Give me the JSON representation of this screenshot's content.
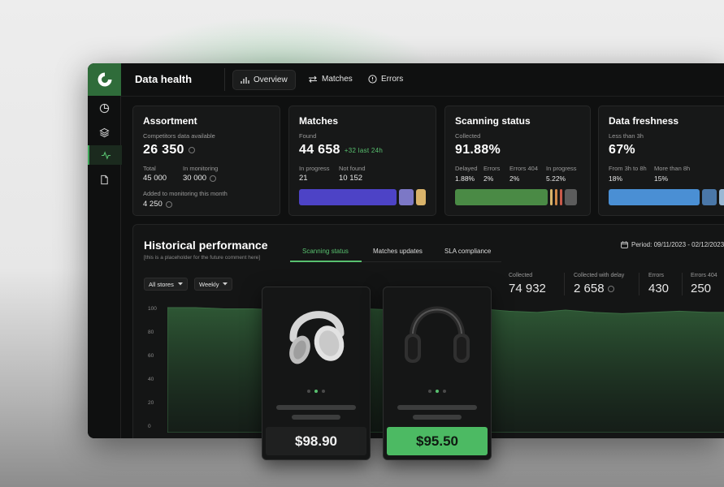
{
  "colors": {
    "accent": "#58c06f",
    "brand": "#2f6c3a",
    "window_bg": "#0f1010",
    "card_bg": "#171818"
  },
  "sidebar": {
    "items": [
      {
        "icon": "pie-chart-icon"
      },
      {
        "icon": "layers-icon"
      },
      {
        "icon": "activity-icon",
        "active": true
      },
      {
        "icon": "document-icon"
      }
    ]
  },
  "header": {
    "title": "Data health",
    "tabs": [
      {
        "label": "Overview",
        "icon": "bar-chart-icon",
        "active": true
      },
      {
        "label": "Matches",
        "icon": "swap-arrows-icon"
      },
      {
        "label": "Errors",
        "icon": "alert-circle-icon"
      }
    ]
  },
  "cards": {
    "assortment": {
      "title": "Assortment",
      "subtitle": "Competitors data available",
      "main": "26 350",
      "total_label": "Total",
      "total": "45 000",
      "monitoring_label": "In monitoring",
      "monitoring": "30 000",
      "added_label": "Added to monitoring this month",
      "added": "4 250"
    },
    "matches": {
      "title": "Matches",
      "subtitle": "Found",
      "main": "44 658",
      "delta": "+32 last 24h",
      "progress_label": "In progress",
      "progress": "21",
      "notfound_label": "Not found",
      "notfound": "10 152",
      "bar": [
        {
          "color": "#4d43c6",
          "value": 0.8
        },
        {
          "color": "#7c78c6",
          "value": 0.12
        },
        {
          "color": "#d9b36a",
          "value": 0.08
        }
      ]
    },
    "scanning": {
      "title": "Scanning status",
      "subtitle": "Collected",
      "main": "91.88%",
      "cols": [
        {
          "label": "Delayed",
          "value": "1.88%"
        },
        {
          "label": "Errors",
          "value": "2%"
        },
        {
          "label": "Errors 404",
          "value": "2%"
        },
        {
          "label": "In progress",
          "value": "5.22%"
        }
      ],
      "bar": [
        {
          "color": "#4a8a45",
          "value": 0.8
        },
        {
          "color": "#d9b36a",
          "value": 0.02
        },
        {
          "color": "#d08a4a",
          "value": 0.02
        },
        {
          "color": "#c95a4a",
          "value": 0.02
        },
        {
          "color": "#5c5c5c",
          "value": 0.11
        }
      ]
    },
    "freshness": {
      "title": "Data freshness",
      "subtitle": "Less than 3h",
      "main": "67%",
      "cols": [
        {
          "label": "From 3h to 8h",
          "value": "18%"
        },
        {
          "label": "More than 8h",
          "value": "15%"
        }
      ],
      "bar": [
        {
          "color": "#4a8fd4",
          "value": 0.78
        },
        {
          "color": "#4a77a8",
          "value": 0.12
        },
        {
          "color": "#9ab8d4",
          "value": 0.1
        }
      ]
    }
  },
  "history": {
    "title": "Historical performance",
    "subtitle": "[this is a placeholder for the future comment here]",
    "tabs": [
      {
        "label": "Scanning status",
        "active": true
      },
      {
        "label": "Matches updates"
      },
      {
        "label": "SLA compliance"
      }
    ],
    "period": "Period: 09/11/2023 - 02/12/2023",
    "filters": {
      "store": "All stores",
      "interval": "Weekly"
    },
    "stats": [
      {
        "label": "Collected",
        "value": "74 932"
      },
      {
        "label": "Collected with delay",
        "value": "2 658"
      },
      {
        "label": "Errors",
        "value": "430"
      },
      {
        "label": "Errors 404",
        "value": "250"
      }
    ]
  },
  "chart_data": {
    "type": "area",
    "yticks": [
      "100",
      "80",
      "60",
      "40",
      "20",
      "0"
    ],
    "ylim": [
      0,
      100
    ],
    "x": [
      0,
      1,
      2,
      3,
      4,
      5,
      6,
      7,
      8,
      9,
      10,
      11,
      12,
      13,
      14,
      15,
      16,
      17,
      18,
      19,
      20
    ],
    "values": [
      100,
      100,
      99,
      99,
      98,
      99,
      100,
      99,
      98,
      99,
      100,
      99,
      97,
      96,
      98,
      96,
      95,
      96,
      97,
      96,
      96
    ]
  },
  "products": [
    {
      "price": "$98.90",
      "image": "white-headphones-image",
      "highlight": false
    },
    {
      "price": "$95.50",
      "image": "black-headphones-image",
      "highlight": true
    }
  ]
}
